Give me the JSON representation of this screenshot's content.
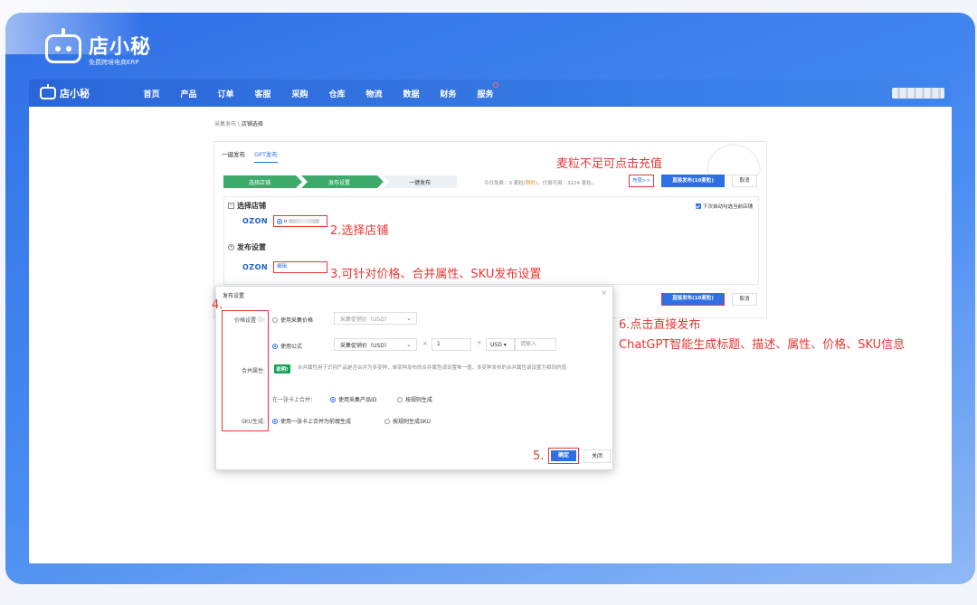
{
  "brand": {
    "name": "店小秘",
    "subtitle": "免费跨境电商ERP"
  },
  "topnav": {
    "logo_name": "店小秘",
    "items": [
      "首页",
      "产品",
      "订单",
      "客服",
      "采购",
      "仓库",
      "物流",
      "数据",
      "财务",
      "服务"
    ]
  },
  "breadcrumb": {
    "parent": "采集发布",
    "sep": " \\ ",
    "current": "店铺选择"
  },
  "tabs": [
    "一键发布",
    "GPT发布"
  ],
  "steps": [
    "选择店铺",
    "发布设置",
    "一键发布"
  ],
  "quota": {
    "free_prefix": "今日免费：0 麦粒(",
    "limited": "限时",
    "rest": ")，付费可用：3224 麦粒。"
  },
  "buttons": {
    "recharge": "充值>>",
    "publish_direct": "直接发布(10麦粒)",
    "cancel": "取消"
  },
  "shop_section": {
    "title": "选择店铺",
    "platform": "OZON",
    "auto_select": "下次自动勾选当前店铺",
    "shop_prefix": "o"
  },
  "publish_section": {
    "title": "发布设置",
    "platform": "OZON",
    "edit": "编辑"
  },
  "dialog": {
    "title": "发布设置",
    "close": "×",
    "price_label": "价格设置 ⓘ:",
    "opt_collected_price": "使用采集价格",
    "sel_collected": "采集促销价（USD）",
    "opt_formula": "使用公式",
    "sel_formula": "采集促销价（USD）",
    "multiply": "×",
    "factor": "1",
    "plus": "+",
    "currency": "USD ▾",
    "input_placeholder": "请输入",
    "merge_label": "合并属性:",
    "tip_badge": "说明!",
    "tip_text": "合并属性用于识别产品是否合并为多变种，单变种发布的合并属性请设置唯一值，多变种发布的合并属性请设置为相同的值",
    "merge_card_label": "在一张卡上合并：",
    "opt_use_product_id": "使用采集产品ID",
    "opt_by_rule": "按规则生成",
    "sku_label": "SKU生成:",
    "opt_sku_merge": "使用一张卡上合并为前缀生成",
    "opt_sku_rule": "按规则生成SKU",
    "ok": "确定",
    "close_btn": "关闭"
  },
  "annotations": {
    "recharge": "麦粒不足可点击充值",
    "step2": "2.选择店铺",
    "step3": "3.可针对价格、合并属性、SKU发布设置",
    "step4": "4.",
    "step5": "5.",
    "step6": "6.点击直接发布",
    "gpt": "ChatGPT智能生成标题、描述、属性、价格、SKU信息"
  },
  "colors": {
    "brand_blue": "#2f6fe6",
    "annotation_red": "#e53935",
    "step_green": "#3daa6a"
  }
}
